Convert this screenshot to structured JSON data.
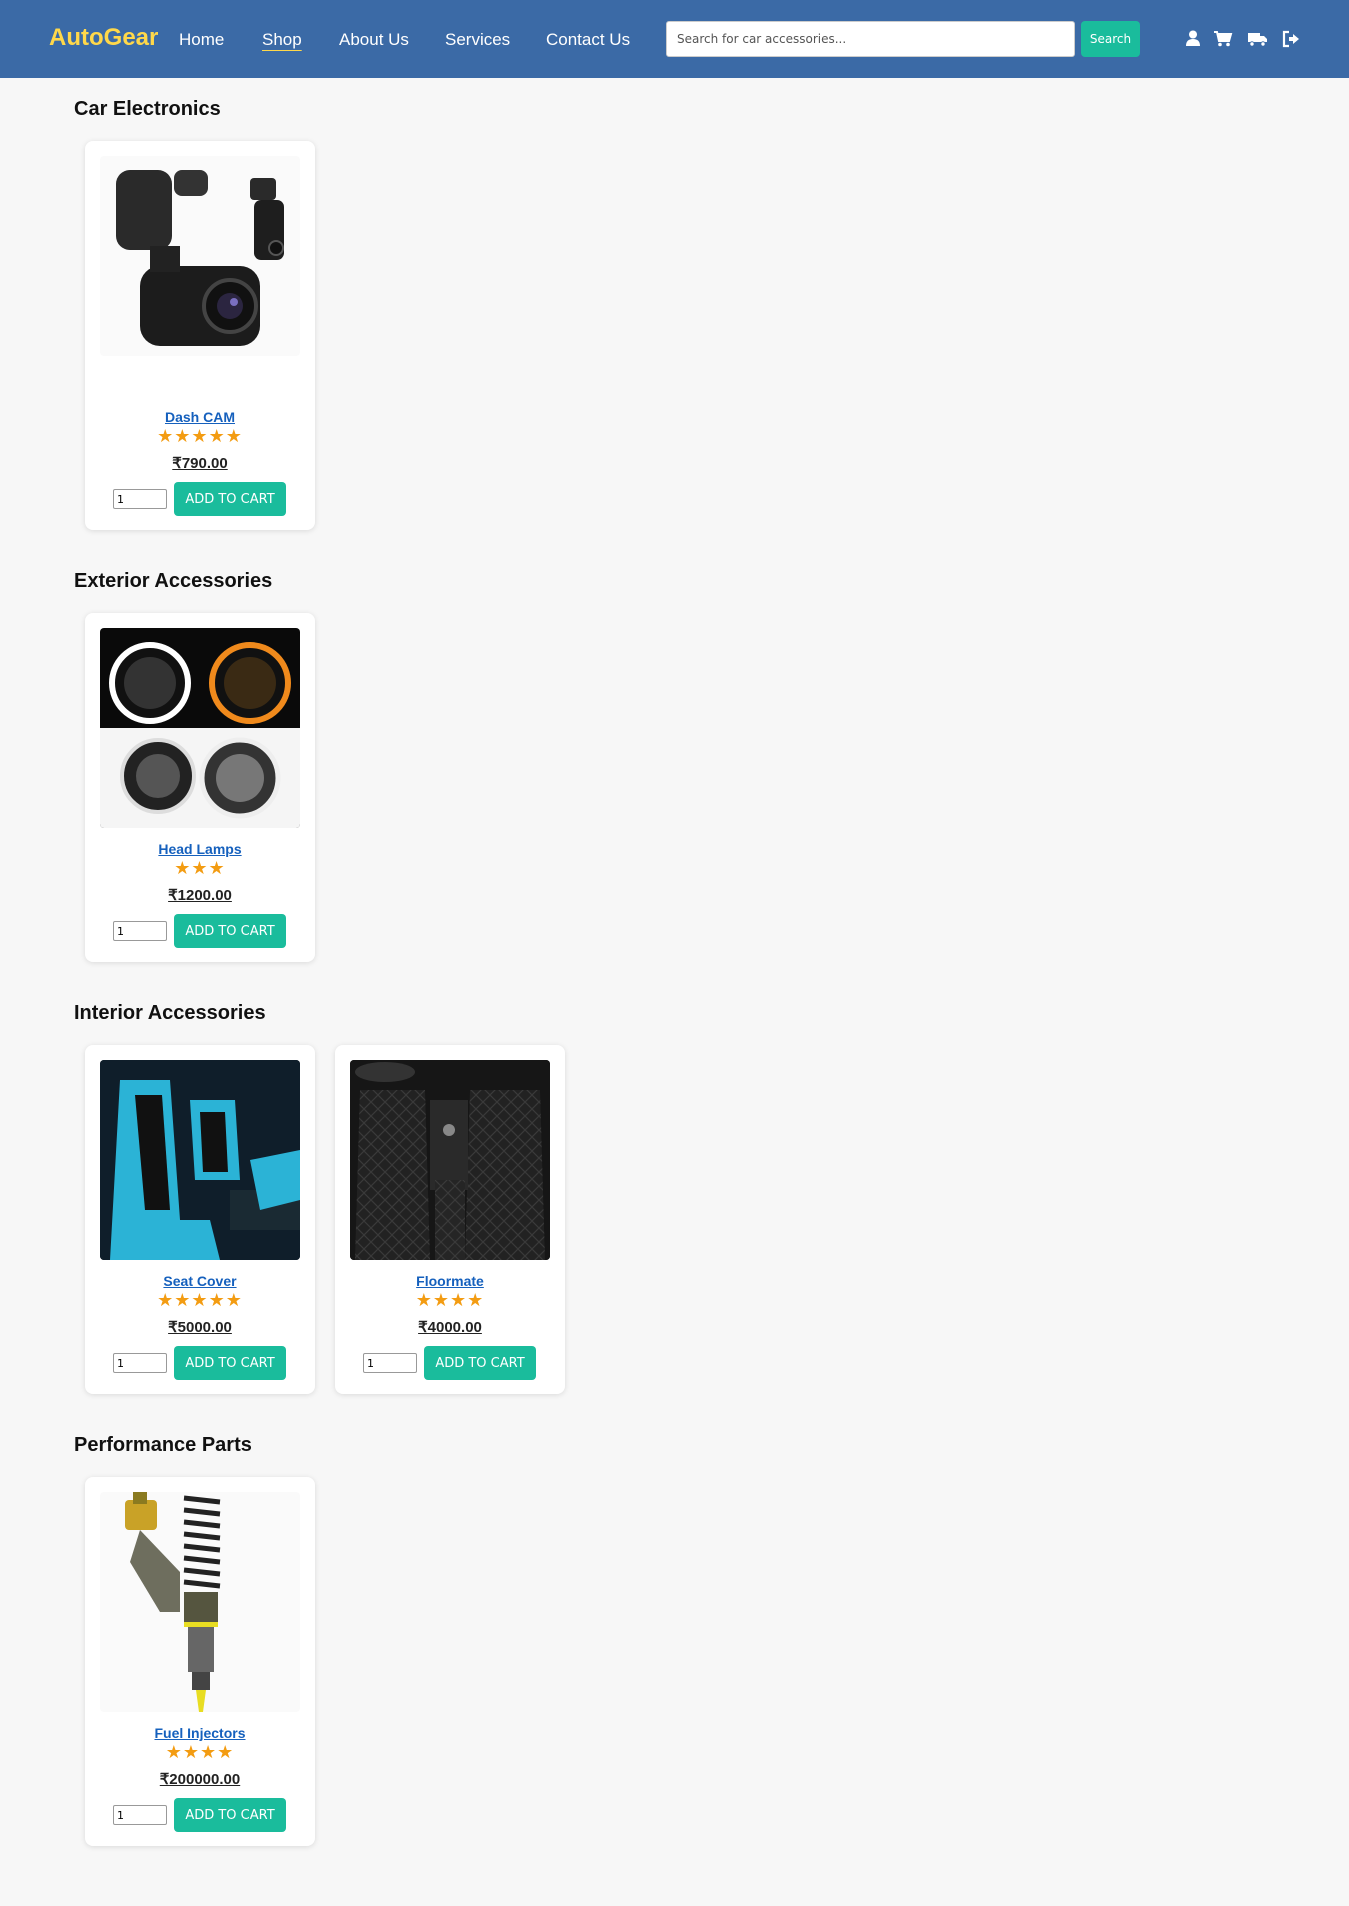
{
  "brand": "AutoGear",
  "nav": {
    "home": "Home",
    "shop": "Shop",
    "about": "About Us",
    "services": "Services",
    "contact": "Contact Us"
  },
  "search": {
    "placeholder": "Search for car accessories...",
    "button": "Search"
  },
  "icons": [
    "user-icon",
    "cart-icon",
    "truck-icon",
    "logout-icon"
  ],
  "colors": {
    "navbar": "#3b6aa6",
    "brand": "#ffd84a",
    "accent": "#1abc9c",
    "link": "#1560bd",
    "star": "#f39c12"
  },
  "sections": [
    {
      "title": "Car Electronics",
      "products": [
        {
          "name": "Dash CAM",
          "stars": "★★★★★",
          "rating": 5,
          "price": "₹790.00",
          "qty": "1",
          "button": "ADD TO CART",
          "image": "dash-cam-image"
        }
      ]
    },
    {
      "title": "Exterior Accessories",
      "products": [
        {
          "name": "Head Lamps",
          "stars": "★★★",
          "rating": 3,
          "price": "₹1200.00",
          "qty": "1",
          "button": "ADD TO CART",
          "image": "head-lamps-image"
        }
      ]
    },
    {
      "title": "Interior Accessories",
      "products": [
        {
          "name": "Seat Cover",
          "stars": "★★★★★",
          "rating": 5,
          "price": "₹5000.00",
          "qty": "1",
          "button": "ADD TO CART",
          "image": "seat-cover-image"
        },
        {
          "name": "Floormate",
          "stars": "★★★★",
          "rating": 4,
          "price": "₹4000.00",
          "qty": "1",
          "button": "ADD TO CART",
          "image": "floor-mat-image"
        }
      ]
    },
    {
      "title": "Performance Parts",
      "products": [
        {
          "name": "Fuel Injectors",
          "stars": "★★★★",
          "rating": 4,
          "price": "₹200000.00",
          "qty": "1",
          "button": "ADD TO CART",
          "image": "fuel-injector-image"
        }
      ]
    }
  ]
}
